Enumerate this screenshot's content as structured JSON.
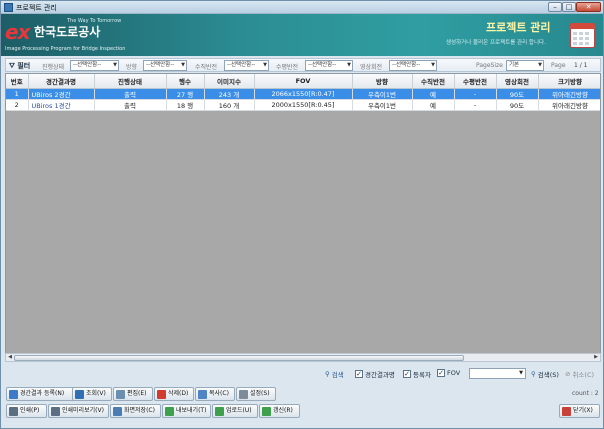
{
  "window": {
    "title": "프로젝트 관리",
    "min": "–",
    "max": "□",
    "close": "✕"
  },
  "banner": {
    "logo_mark": "ex",
    "logo_org": "한국도로공사",
    "logo_tagline": "The Way To Tomorrow",
    "logo_subtitle": "Image Processing Program for Bridge Inspection",
    "title": "프로젝트 관리",
    "description": "생성하거나 불러온 프로젝트를 관리 합니다."
  },
  "filter": {
    "label": "필터",
    "fields": [
      {
        "label": "진행상태",
        "value": "--선택안함--"
      },
      {
        "label": "방향",
        "value": "--선택안함--"
      },
      {
        "label": "수직반전",
        "value": "--선택안함--"
      },
      {
        "label": "수평반전",
        "value": "--선택안함--"
      },
      {
        "label": "영상회전",
        "value": "--선택안함--"
      }
    ],
    "pagesize_label": "PageSize",
    "pagesize_value": "기본",
    "page_label": "Page",
    "page_value": "1 / 1"
  },
  "grid": {
    "columns": [
      "번호",
      "경간결과명",
      "진행상태",
      "행수",
      "이미지수",
      "FOV",
      "방향",
      "수직반전",
      "수평반전",
      "영상회전",
      "크기방향"
    ],
    "rows": [
      [
        "1",
        "UBiros 2경간",
        "출력",
        "27 행",
        "243 개",
        "2066x1550[R:0.47]",
        "우측이1번",
        "예",
        "-",
        "90도",
        "위아래긴방향"
      ],
      [
        "2",
        "UBiros 1경간",
        "출력",
        "18 행",
        "160 개",
        "2000x1550[R:0.45]",
        "우측이1번",
        "예",
        "-",
        "90도",
        "위아래긴방향"
      ]
    ]
  },
  "options": {
    "search_icon_label": "검색",
    "checks": [
      {
        "label": "경간결과명",
        "checked": "✓"
      },
      {
        "label": "등록자",
        "checked": "✓"
      },
      {
        "label": "FOV",
        "checked": "✓"
      }
    ],
    "search_button": "검색(S)",
    "cancel_button": "취소(C)"
  },
  "count_text": "count : 2",
  "buttons_row1": [
    {
      "label": "경간결과 등록(N)",
      "color": "#3d7ac9"
    },
    {
      "label": "조회(V)",
      "color": "#2f6fb4"
    },
    {
      "label": "편집(E)",
      "color": "#6b8fb0"
    },
    {
      "label": "삭제(D)",
      "color": "#d23c2f"
    },
    {
      "label": "복사(C)",
      "color": "#4f84c4"
    },
    {
      "label": "설정(S)",
      "color": "#7d8c98"
    }
  ],
  "buttons_row2": [
    {
      "label": "인쇄(P)",
      "color": "#5b6f82"
    },
    {
      "label": "인쇄미리보기(V)",
      "color": "#5b6f82"
    },
    {
      "label": "화면저장(C)",
      "color": "#4b7cb3"
    },
    {
      "label": "내보내기(T)",
      "color": "#3ea04c"
    },
    {
      "label": "업로드(U)",
      "color": "#3ea04c"
    },
    {
      "label": "갱신(R)",
      "color": "#3ea04c"
    }
  ],
  "close_button": "닫기(X)"
}
